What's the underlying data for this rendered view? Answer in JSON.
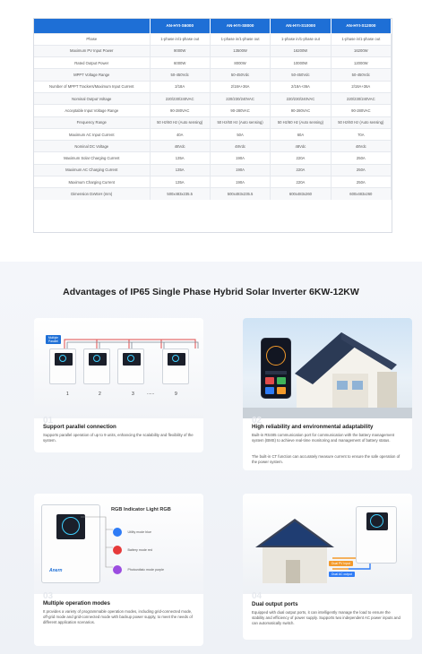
{
  "spec_table": {
    "headers": [
      "",
      "AN-HYI-S6000",
      "AN-HYI-S8000",
      "AN-HYI-S10000",
      "AN-HYI-S12000"
    ],
    "rows": [
      [
        "Phase",
        "1-phase in/1-phase out",
        "1-phase in/1-phase out",
        "1-phase in/1-phase out",
        "1-phase in/1-phase out"
      ],
      [
        "Maximum PV Input Power",
        "9000W",
        "13500W",
        "16200W",
        "16200W"
      ],
      [
        "Rated Output Power",
        "6000W",
        "8000W",
        "10000W",
        "12000W"
      ],
      [
        "MPPT Voltage Range",
        "50-450Vdc",
        "50-450Vdc",
        "50-450Vdc",
        "50-450Vdc"
      ],
      [
        "Number of MPPT Trackers/Maximum Input Current",
        "2/18A",
        "2/18A+36A",
        "2/18A+36A",
        "2/18A+36A"
      ],
      [
        "Nominal Output Voltage",
        "220/230/240VAC",
        "220/230/240VAC",
        "220/230/240VAC",
        "220/230/240VAC"
      ],
      [
        "Acceptable Input Voltage Range",
        "90-280VAC",
        "90-280VAC",
        "90-280VAC",
        "90-280VAC"
      ],
      [
        "Frequency Range",
        "50 Hz/60 Hz (Auto sensing)",
        "50 Hz/60 Hz (Auto sensing)",
        "50 Hz/60 Hz (Auto sensing)",
        "50 Hz/60 Hz (Auto sensing)"
      ],
      [
        "Maximum AC Input Current",
        "40A",
        "50A",
        "60A",
        "70A"
      ],
      [
        "Nominal DC Voltage",
        "48Vdc",
        "48Vdc",
        "48Vdc",
        "48Vdc"
      ],
      [
        "Maximum Solar Charging Current",
        "135A",
        "190A",
        "220A",
        "250A"
      ],
      [
        "Maximum AC Charging Current",
        "135A",
        "190A",
        "220A",
        "250A"
      ],
      [
        "Maximum Charging Current",
        "135A",
        "190A",
        "220A",
        "250A"
      ],
      [
        "Dimension DxWxH (mm)",
        "500x483x235.5",
        "500x483x235.5",
        "600x483x260",
        "600x483x260"
      ]
    ]
  },
  "advantages": {
    "title": "Advantages of IP65 Single Phase Hybrid Solar Inverter 6KW-12KW",
    "cards": [
      {
        "num": "01",
        "title": "Support parallel connection",
        "desc": "Supports parallel operation of up to 9 units, enhancing the scalability and flexibility of the system.",
        "badge": "Multiple Parallel",
        "unit_labels": [
          "1",
          "2",
          "3",
          "9"
        ],
        "ellipsis": "......"
      },
      {
        "num": "02",
        "title": "High reliability and environmental adaptability",
        "desc": "Built-in RS485 communication port for communication with the battery management system (BMS) to achieve real-time monitoring and management of battery status.",
        "desc2": "The built-in CT function can accurately measure current to ensure the safe operation of the power system."
      },
      {
        "num": "03",
        "title": "Multiple operation modes",
        "desc": "It provides a variety of programmable operation modes, including grid-connected mode, off-grid mode and grid-connected mode with backup power supply, to meet the needs of different application scenarios.",
        "rgb_title": "RGB Indicator Light RGB",
        "rgb_labels": [
          "Utility mode blue",
          "Battery mode red",
          "Photovoltaic mode purple"
        ],
        "colors": {
          "blue": "#2f7cf6",
          "red": "#e63a3a",
          "purple": "#9b4de0"
        }
      },
      {
        "num": "04",
        "title": "Dual output ports",
        "desc": "Equipped with dual output ports, it can intelligently manage the load to ensure the stability and efficiency of power supply. Supports two independent AC power inputs and can automatically switch.",
        "tag1": "Dual PV Input",
        "tag2": "Dual AC output"
      }
    ]
  },
  "brand": "Anern",
  "colors": {
    "header_blue": "#1e6fd6",
    "accent_orange": "#f39a2b"
  }
}
